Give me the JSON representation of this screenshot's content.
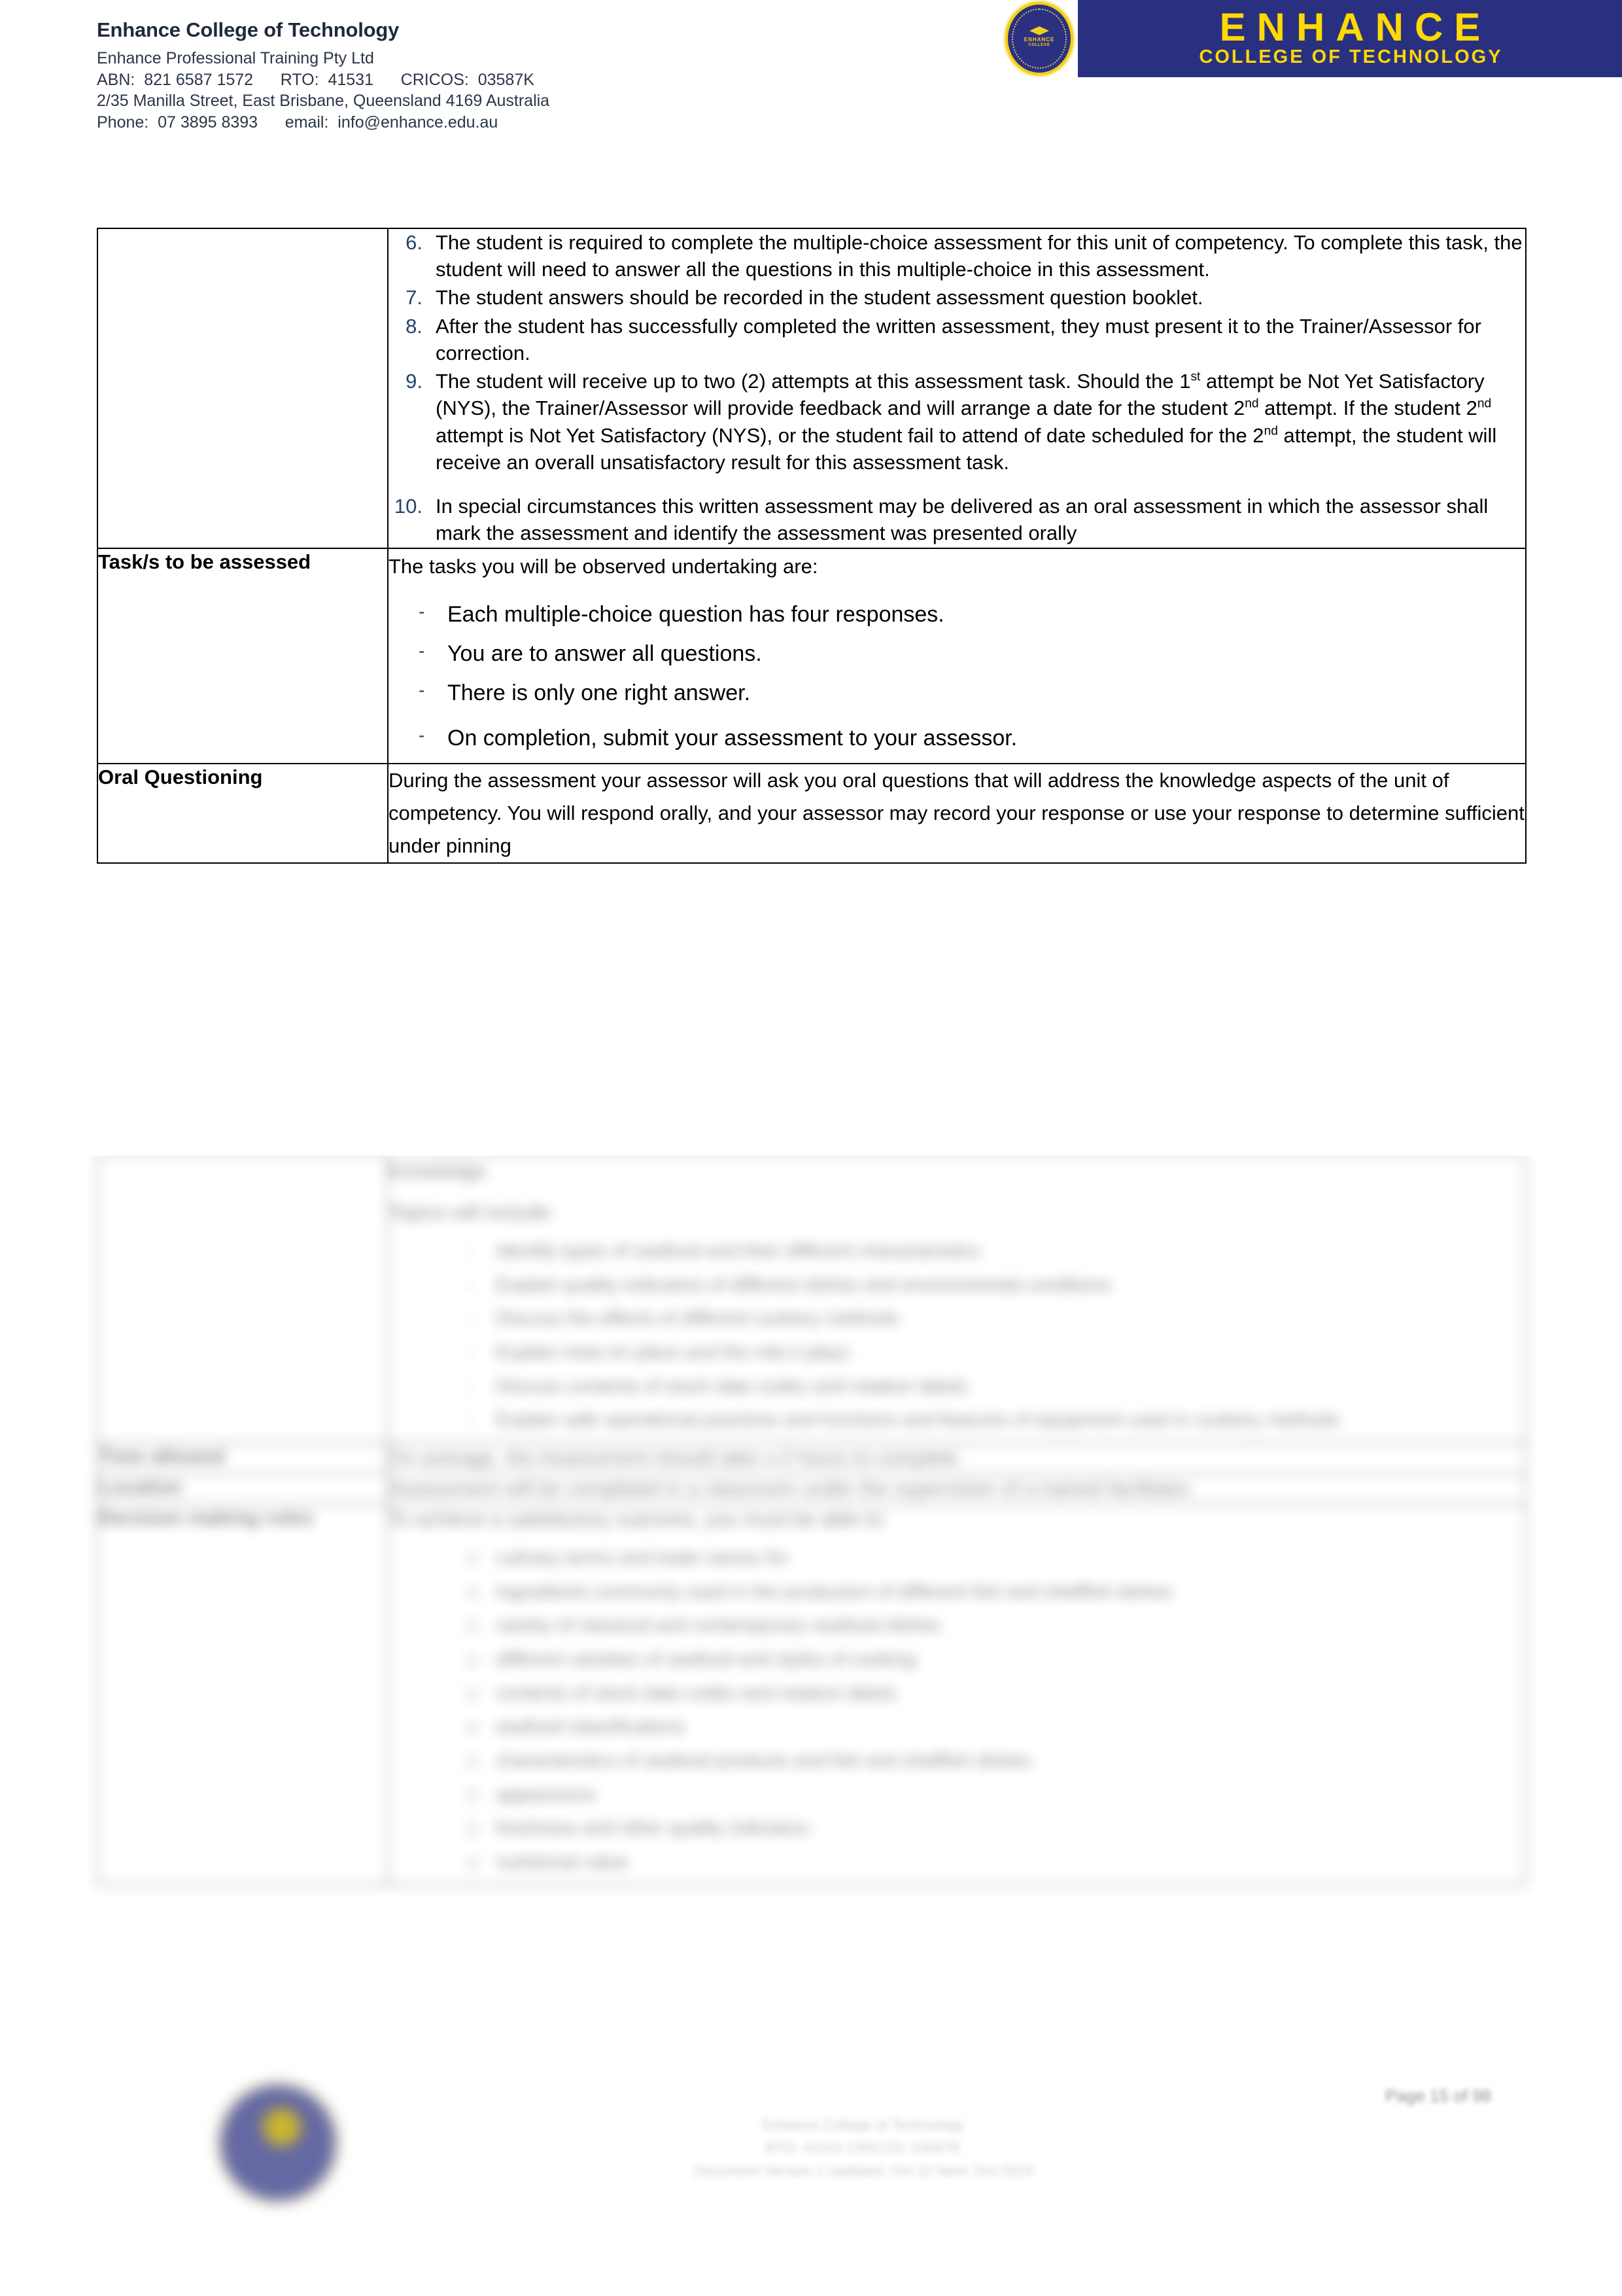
{
  "header": {
    "org_name": "Enhance College of Technology",
    "legal_name": "Enhance Professional Training Pty Ltd",
    "registration_line": "ABN:  821 6587 1572      RTO:  41531      CRICOS:  03587K",
    "address_line": "2/35 Manilla Street, East Brisbane, Queensland 4169 Australia",
    "contact_line": "Phone:  07 3895 8393      email:  info@enhance.edu.au",
    "logo": {
      "seal_word_top": "ENHANCE",
      "seal_word_bottom": "COLLEGE",
      "main_text": "ENHANCE",
      "sub_text": "COLLEGE OF TECHNOLOGY",
      "navy": "#2a3080",
      "yellow": "#ffd900"
    }
  },
  "colors": {
    "list_number": "#24456b",
    "border": "#000000",
    "body_text": "#000000",
    "header_text": "#2b3648"
  },
  "table": {
    "rows": [
      {
        "label": "",
        "numbered_items": [
          {
            "num": "6.",
            "text": "The student is required to complete the multiple-choice assessment for this unit of competency. To complete this task, the student will need to answer all the questions in this multiple-choice in this assessment."
          },
          {
            "num": "7.",
            "text": "The student answers should be recorded in the student assessment question booklet."
          },
          {
            "num": "8.",
            "text": "After the student has successfully completed the written assessment, they must present it to the Trainer/Assessor for correction."
          },
          {
            "num": "9.",
            "text": "The student will receive up to two (2) attempts at this assessment task. Should the 1st attempt be Not Yet Satisfactory (NYS), the Trainer/Assessor will provide feedback and will arrange a date for the student 2nd attempt. If the student 2nd attempt is Not Yet Satisfactory (NYS), or the student fail to attend of date scheduled for the 2nd attempt, the student will receive an overall unsatisfactory result for this assessment task."
          },
          {
            "num": "10.",
            "text": "In special circumstances this written assessment may be delivered as an oral assessment in which the assessor shall mark the assessment and identify the assessment was presented orally"
          }
        ]
      },
      {
        "label": "Task/s to be assessed",
        "intro": "The tasks you will be observed undertaking are:",
        "bullets": [
          "Each multiple-choice question has four responses.",
          "You are to answer all questions.",
          "There is only one right answer.",
          "On completion, submit your assessment to your assessor."
        ],
        "bullet_marker": "-"
      },
      {
        "label": "Oral Questioning",
        "paragraph": "During the assessment your assessor will ask you oral questions that will address the knowledge aspects of the unit of competency.  You will respond orally, and your assessor may record your response or use your response to determine sufficient under pinning"
      }
    ]
  },
  "blurred_region": {
    "note_label": "illegible-blurred-content",
    "oral_continued": {
      "line1": "knowledge.",
      "line2": "Topics will include:",
      "bullets": [
        "Identify types of seafood and their different characteristics",
        "Explain quality indicators of different dishes and environmental conditions",
        "Discuss the effects of different cookery methods",
        "Explain mise en place and the role it plays",
        "Discuss contents of stock date codes and rotation labels",
        "Explain safe operational practices and functions and features of equipment used in cookery methods"
      ]
    },
    "rows": [
      {
        "label": "Time allowed",
        "value": "On average, the Assessment should take x-2 hours to complete"
      },
      {
        "label": "Location",
        "value": "Assessment will be completed in a classroom under the supervision of a trained facilitator."
      },
      {
        "label": "Decision making rules",
        "value": "To achieve a satisfactory outcome, you must be able to:",
        "bullets": [
          "culinary terms and trade names for",
          "ingredients commonly used in the production of different fish and shellfish dishes",
          "variety of classical and contemporary seafood dishes",
          "different varieties of seafood and styles of cooking",
          "contents of stock date codes and rotation labels",
          "seafood classifications",
          "characteristics of seafood products and fish and shellfish dishes",
          "appearance",
          "freshness and other quality indicators",
          "nutritional value"
        ]
      }
    ]
  },
  "footer": {
    "line1": "Enhance College of Technology",
    "line2": "RTO: 41531    CRICOS: 03587K",
    "line3": "Document Version  1      Updated: Oct 22      Next:  Oct 2023",
    "page_number": "Page 15 of 98"
  }
}
